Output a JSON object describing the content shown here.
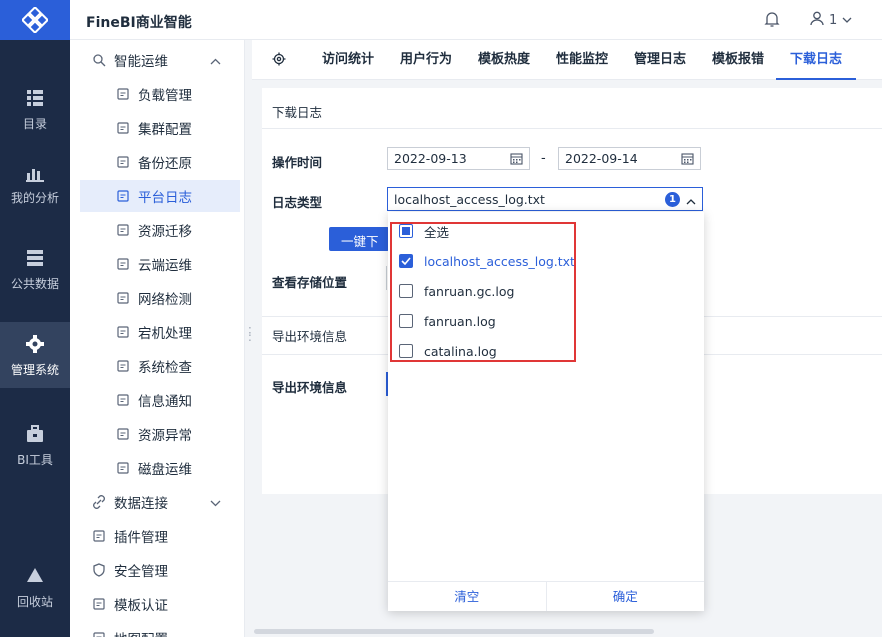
{
  "app": {
    "brand": "FineBI商业智能",
    "user_label": "1"
  },
  "rail": [
    {
      "name": "catalog",
      "label": "目录",
      "icon": "catalog-icon",
      "active": false
    },
    {
      "name": "my-analysis",
      "label": "我的分析",
      "icon": "chart-icon",
      "active": false
    },
    {
      "name": "public-data",
      "label": "公共数据",
      "icon": "database-icon",
      "active": false
    },
    {
      "name": "system-admin",
      "label": "管理系统",
      "icon": "gear-icon",
      "active": true
    },
    {
      "name": "bi-tools",
      "label": "BI工具",
      "icon": "toolbox-icon",
      "active": false
    },
    {
      "name": "recycle-bin",
      "label": "回收站",
      "icon": "recycle-icon",
      "active": false
    }
  ],
  "tree": [
    {
      "label": "智能运维",
      "level": 1,
      "icon": "ops-icon",
      "expand": "up"
    },
    {
      "label": "负载管理",
      "level": 2,
      "icon": "load-icon"
    },
    {
      "label": "集群配置",
      "level": 2,
      "icon": "cluster-icon"
    },
    {
      "label": "备份还原",
      "level": 2,
      "icon": "backup-icon"
    },
    {
      "label": "平台日志",
      "level": 2,
      "icon": "log-icon",
      "active": true
    },
    {
      "label": "资源迁移",
      "level": 2,
      "icon": "migrate-icon"
    },
    {
      "label": "云端运维",
      "level": 2,
      "icon": "cloud-icon"
    },
    {
      "label": "网络检测",
      "level": 2,
      "icon": "network-icon"
    },
    {
      "label": "宕机处理",
      "level": 2,
      "icon": "crash-icon"
    },
    {
      "label": "系统检查",
      "level": 2,
      "icon": "check-icon"
    },
    {
      "label": "信息通知",
      "level": 2,
      "icon": "notify-icon"
    },
    {
      "label": "资源异常",
      "level": 2,
      "icon": "warning-icon"
    },
    {
      "label": "磁盘运维",
      "level": 2,
      "icon": "disk-icon"
    },
    {
      "label": "数据连接",
      "level": 1,
      "icon": "link-icon",
      "expand": "down"
    },
    {
      "label": "插件管理",
      "level": 1,
      "icon": "plugin-icon"
    },
    {
      "label": "安全管理",
      "level": 1,
      "icon": "shield-icon"
    },
    {
      "label": "模板认证",
      "level": 1,
      "icon": "template-icon"
    },
    {
      "label": "地图配置",
      "level": 1,
      "icon": "map-icon"
    }
  ],
  "tabs": [
    "访问统计",
    "用户行为",
    "模板热度",
    "性能监控",
    "管理日志",
    "模板报错",
    "下载日志"
  ],
  "active_tab": "下载日志",
  "section1": {
    "title": "下载日志",
    "time_label": "操作时间",
    "date_from": "2022-09-13",
    "date_sep": "-",
    "date_to": "2022-09-14",
    "type_label": "日志类型",
    "type_value": "localhost_access_log.txt",
    "type_count": "1",
    "download_button": "一键下载",
    "storage_label": "查看存储位置"
  },
  "section2": {
    "title": "导出环境信息",
    "export_label": "导出环境信息"
  },
  "dropdown": {
    "options": [
      {
        "label": "全选",
        "state": "partial"
      },
      {
        "label": "localhost_access_log.txt",
        "state": "checked"
      },
      {
        "label": "fanruan.gc.log",
        "state": "unchecked"
      },
      {
        "label": "fanruan.log",
        "state": "unchecked"
      },
      {
        "label": "catalina.log",
        "state": "unchecked"
      }
    ],
    "clear_label": "清空",
    "confirm_label": "确定"
  },
  "colors": {
    "accent": "#2b5fd9",
    "rail_bg": "#1c2b46",
    "highlight": "#e03636"
  }
}
